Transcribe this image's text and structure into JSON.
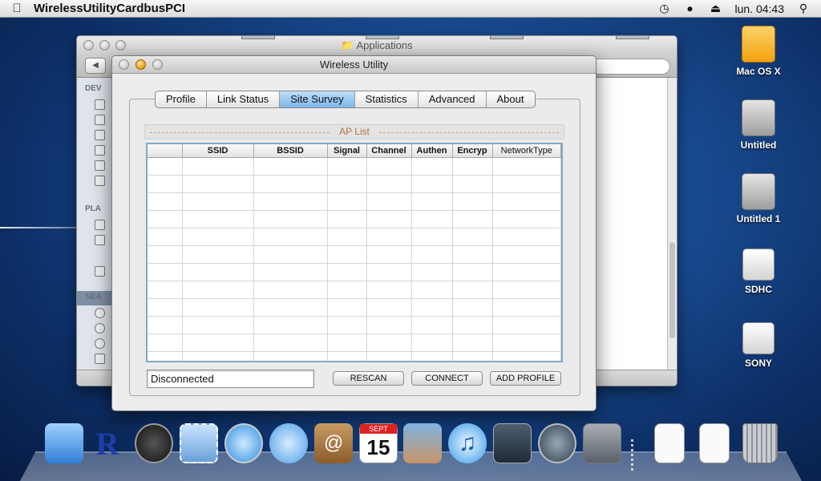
{
  "menubar": {
    "app_name": "WirelessUtilityCardbusPCI",
    "clock": "lun. 04:43",
    "icons": [
      "apple-icon",
      "time-machine-icon",
      "bluetooth-icon",
      "eject-icon",
      "spotlight-search-icon"
    ]
  },
  "finder": {
    "title": "Applications",
    "sidebar_sections": [
      "DEV",
      "PLA",
      "SEA"
    ],
    "search_placeholder": ""
  },
  "wireless_utility": {
    "title": "Wireless Utility",
    "tabs": [
      {
        "label": "Profile",
        "active": false
      },
      {
        "label": "Link Status",
        "active": false
      },
      {
        "label": "Site Survey",
        "active": true
      },
      {
        "label": "Statistics",
        "active": false
      },
      {
        "label": "Advanced",
        "active": false
      },
      {
        "label": "About",
        "active": false
      }
    ],
    "ap_list_title": "AP List",
    "columns": [
      "",
      "SSID",
      "BSSID",
      "Signal",
      "Channel",
      "Authen",
      "Encryp",
      "NetworkType"
    ],
    "rows": [],
    "status": "Disconnected",
    "buttons": {
      "rescan": "RESCAN",
      "connect": "CONNECT",
      "add_profile": "ADD PROFILE"
    }
  },
  "desktop_icons": [
    {
      "label": "Mac OS X",
      "kind": "usb-drive-icon"
    },
    {
      "label": "Untitled",
      "kind": "hard-disk-icon"
    },
    {
      "label": "Untitled 1",
      "kind": "hard-disk-icon"
    },
    {
      "label": "SDHC",
      "kind": "sd-card-icon"
    },
    {
      "label": "SONY",
      "kind": "sd-card-icon"
    }
  ],
  "dock": {
    "items": [
      "finder-icon",
      "r-plus-app-icon",
      "dashboard-icon",
      "mail-icon",
      "safari-icon",
      "ichat-icon",
      "address-book-icon",
      "ical-icon",
      "iphoto-icon",
      "itunes-icon",
      "spaces-icon",
      "time-machine-icon",
      "system-preferences-icon",
      "pdf-document-icon",
      "pdf-document-icon",
      "trash-icon"
    ],
    "calendar": {
      "month": "SEPT",
      "day": "15"
    }
  },
  "colors": {
    "active_tab": "#7ab7ea",
    "legend_text": "#b07840",
    "table_border": "#7fa8cc",
    "desktop_blue": "#1a4e95"
  }
}
